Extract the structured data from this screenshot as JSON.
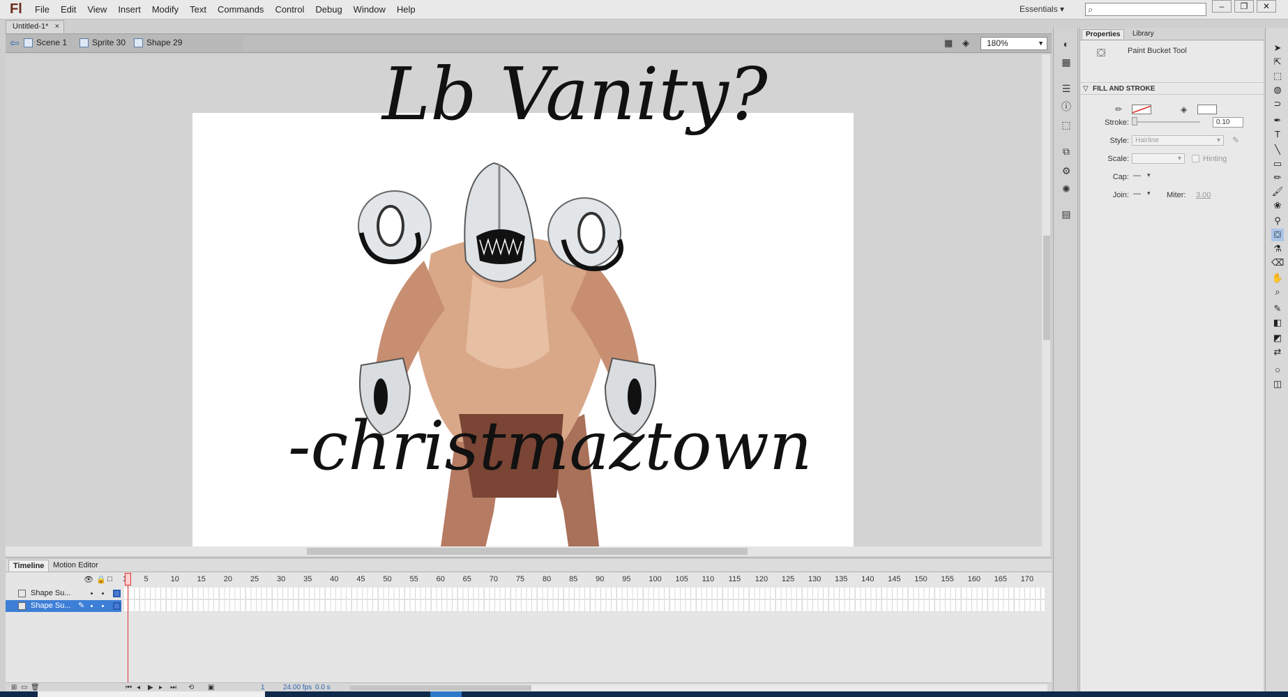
{
  "app": {
    "logo": "Fl"
  },
  "menu": [
    "File",
    "Edit",
    "View",
    "Insert",
    "Modify",
    "Text",
    "Commands",
    "Control",
    "Debug",
    "Window",
    "Help"
  ],
  "workspace": "Essentials",
  "search": {
    "placeholder": "",
    "value": ""
  },
  "window_controls": [
    "–",
    "❐",
    "✕"
  ],
  "document": {
    "tab_title": "Untitled-1*",
    "close": "×"
  },
  "breadcrumbs": [
    "Scene 1",
    "Sprite 30",
    "Shape 29"
  ],
  "zoom": {
    "value": "180%"
  },
  "stage": {
    "title_text": "Lb Vanity?",
    "caption_text": "-christmaztown",
    "background": "#ffffff"
  },
  "timeline": {
    "tabs": [
      "Timeline",
      "Motion Editor"
    ],
    "frame_ticks": [
      "1",
      "5",
      "10",
      "15",
      "20",
      "25",
      "30",
      "35",
      "40",
      "45",
      "50",
      "55",
      "60",
      "65",
      "70",
      "75",
      "80",
      "85",
      "90",
      "95",
      "100",
      "105",
      "110",
      "115",
      "120",
      "125",
      "130",
      "135",
      "140",
      "145",
      "150",
      "155",
      "160",
      "165",
      "170"
    ],
    "layers": [
      {
        "name": "Shape Su...",
        "selected": false
      },
      {
        "name": "Shape Su...",
        "selected": true
      }
    ],
    "footer": {
      "frame": "1",
      "fps": "24.00 fps",
      "time": "0.0 s"
    }
  },
  "properties": {
    "tabs": [
      "Properties",
      "Library"
    ],
    "tool_name": "Paint Bucket Tool",
    "section": "FILL AND STROKE",
    "stroke_label": "Stroke:",
    "stroke_value": "0.10",
    "style_label": "Style:",
    "style_value": "Hairline",
    "scale_label": "Scale:",
    "hinting_label": "Hinting",
    "cap_label": "Cap:",
    "cap_value": "—",
    "join_label": "Join:",
    "join_value": "—",
    "miter_label": "Miter:",
    "miter_value": "3.00"
  },
  "colors": {
    "accent": "#3d7fd6",
    "playhead": "#e03030",
    "taskbar": "#0f2a4a"
  }
}
